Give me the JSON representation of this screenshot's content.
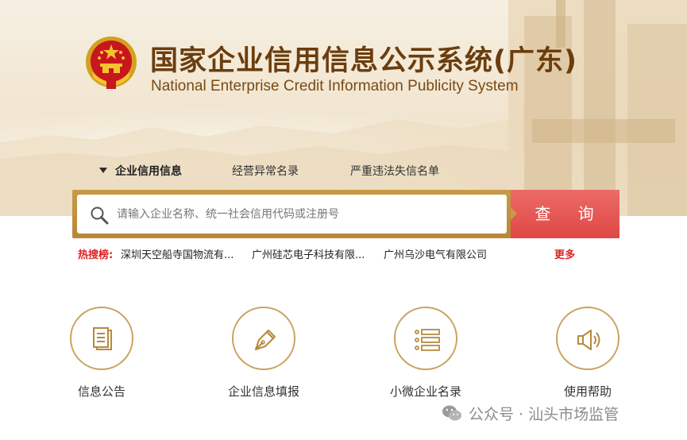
{
  "header": {
    "title_cn": "国家企业信用信息公示系统(广东)",
    "title_en": "National Enterprise Credit Information Publicity System",
    "emblem_icon": "national-emblem-icon"
  },
  "tabs": [
    {
      "label": "企业信用信息",
      "active": true
    },
    {
      "label": "经营异常名录",
      "active": false
    },
    {
      "label": "严重违法失信名单",
      "active": false
    }
  ],
  "search": {
    "placeholder": "请输入企业名称、统一社会信用代码或注册号",
    "value": "",
    "button_label": "查 询",
    "icon": "search-icon"
  },
  "hot_search": {
    "label": "热搜榜:",
    "items": [
      "深圳天空船寺国物流有...",
      "广州硅芯电子科技有限...",
      "广州乌沙电气有限公司"
    ],
    "more_label": "更多"
  },
  "features": [
    {
      "label": "信息公告",
      "icon": "document-icon"
    },
    {
      "label": "企业信息填报",
      "icon": "pen-icon"
    },
    {
      "label": "小微企业名录",
      "icon": "list-icon"
    },
    {
      "label": "使用帮助",
      "icon": "speaker-icon"
    }
  ],
  "watermark": {
    "text": "公众号 · 汕头市场监管"
  },
  "colors": {
    "brand_brown": "#6b3d0e",
    "gold": "#c79a47",
    "search_red": "#e4514f",
    "hot_red": "#d22222"
  }
}
